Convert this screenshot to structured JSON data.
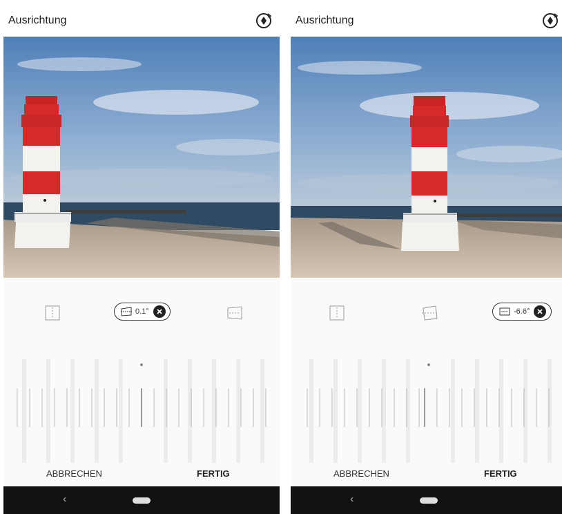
{
  "screens": [
    {
      "title": "Ausrichtung",
      "active_tool": "horizontal",
      "value_label": "0.1°",
      "cancel_label": "ABBRECHEN",
      "done_label": "FERTIG"
    },
    {
      "title": "Ausrichtung",
      "active_tool": "perspective",
      "value_label": "-6.6°",
      "cancel_label": "ABBRECHEN",
      "done_label": "FERTIG"
    }
  ],
  "icons": {
    "rotate": "rotate-icon",
    "vertical": "vertical-straighten-icon",
    "horizontal": "horizontal-straighten-icon",
    "perspective": "perspective-icon",
    "clear": "close-icon",
    "back": "back-icon",
    "home": "home-icon"
  },
  "nav": {
    "back_glyph": "‹"
  },
  "colors": {
    "lighthouse_red": "#d62a2a",
    "lighthouse_white": "#f2f2ee",
    "sky": "#6f96c6",
    "sea": "#2f4a63",
    "sand": "#cfbfae",
    "navbar": "#111111"
  }
}
